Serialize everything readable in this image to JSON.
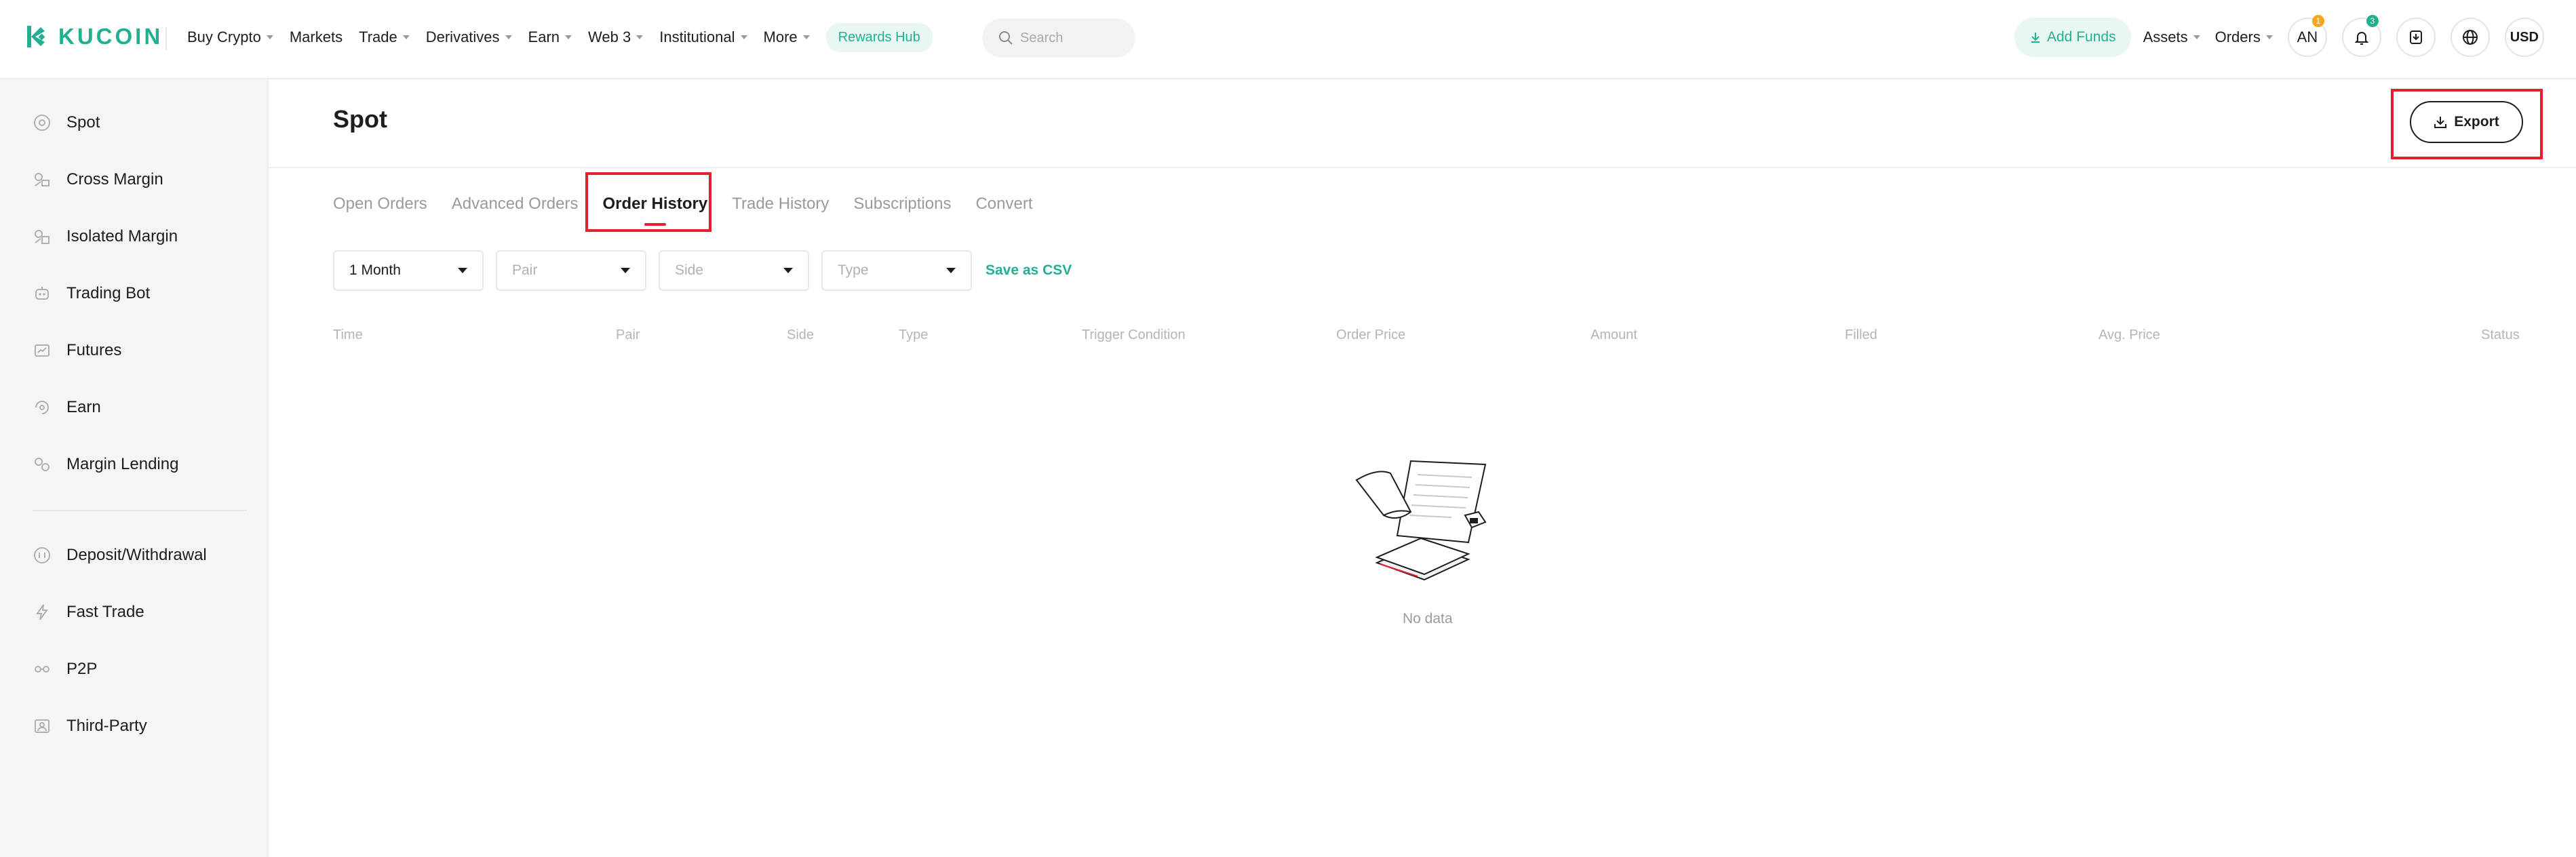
{
  "brand": {
    "name": "KUCOIN",
    "color": "#23af91"
  },
  "topnav": {
    "items": [
      {
        "label": "Buy Crypto",
        "caret": true
      },
      {
        "label": "Markets",
        "caret": false
      },
      {
        "label": "Trade",
        "caret": true
      },
      {
        "label": "Derivatives",
        "caret": true
      },
      {
        "label": "Earn",
        "caret": true
      },
      {
        "label": "Web 3",
        "caret": true
      },
      {
        "label": "Institutional",
        "caret": true
      },
      {
        "label": "More",
        "caret": true
      }
    ],
    "rewards_label": "Rewards Hub",
    "search_placeholder": "Search",
    "add_funds_label": "Add Funds",
    "assets_label": "Assets",
    "orders_label": "Orders",
    "avatar_initials": "AN",
    "avatar_badge": "1",
    "notif_badge": "3",
    "currency": "USD"
  },
  "sidebar": {
    "group1": [
      {
        "label": "Spot",
        "icon": "spot-icon"
      },
      {
        "label": "Cross Margin",
        "icon": "cross-margin-icon"
      },
      {
        "label": "Isolated Margin",
        "icon": "isolated-margin-icon"
      },
      {
        "label": "Trading Bot",
        "icon": "trading-bot-icon"
      },
      {
        "label": "Futures",
        "icon": "futures-icon"
      },
      {
        "label": "Earn",
        "icon": "earn-icon"
      },
      {
        "label": "Margin Lending",
        "icon": "margin-lending-icon"
      }
    ],
    "group2": [
      {
        "label": "Deposit/Withdrawal",
        "icon": "deposit-withdrawal-icon"
      },
      {
        "label": "Fast Trade",
        "icon": "fast-trade-icon"
      },
      {
        "label": "P2P",
        "icon": "p2p-icon"
      },
      {
        "label": "Third-Party",
        "icon": "third-party-icon"
      }
    ]
  },
  "main": {
    "title": "Spot",
    "export_label": "Export",
    "tabs": [
      "Open Orders",
      "Advanced Orders",
      "Order History",
      "Trade History",
      "Subscriptions",
      "Convert"
    ],
    "active_tab": "Order History",
    "filters": {
      "period": "1 Month",
      "pair_placeholder": "Pair",
      "side_placeholder": "Side",
      "type_placeholder": "Type",
      "save_csv_label": "Save as CSV"
    },
    "columns": [
      "Time",
      "Pair",
      "Side",
      "Type",
      "Trigger Condition",
      "Order Price",
      "Amount",
      "Filled",
      "Avg. Price",
      "Status"
    ],
    "empty_text": "No data"
  },
  "colors": {
    "accent": "#23af91",
    "highlight": "#e3202e",
    "badge_orange": "#f3a721"
  }
}
